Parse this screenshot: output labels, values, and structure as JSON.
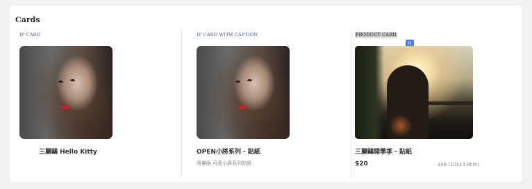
{
  "section_title": "Cards",
  "columns": [
    {
      "label": "IP CARD",
      "title": "三麗鷗 Hello Kitty"
    },
    {
      "label": "IP CARD WITH CAPTION",
      "title": "OPEN小將系列 - 貼紙",
      "caption": "限量版 可愛小將系列貼紙"
    },
    {
      "label": "PRODUCT CARD",
      "title": "三麗鷗開學季 - 貼紙",
      "price": "$20",
      "size": "4x6 (10x14.8cm)"
    }
  ],
  "translate_icon": "translate-icon",
  "accent_color": "#4a5f8a"
}
